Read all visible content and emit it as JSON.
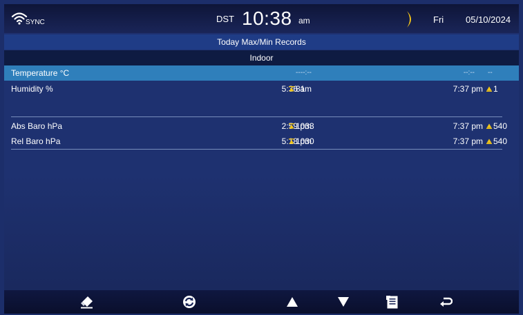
{
  "status": {
    "sync_label": "SYNC",
    "dst_label": "DST",
    "time": "10:38",
    "ampm": "am",
    "day": "Fri",
    "date": "05/10/2024"
  },
  "header": {
    "title": "Today Max/Min Records",
    "section": "Indoor"
  },
  "rows": [
    {
      "label": "Temperature °C",
      "max_time": "--:--",
      "max_value": "--",
      "min_time": "--:--",
      "min_value": "--",
      "selected": true
    },
    {
      "label": "Humidity %",
      "max_time": "5:36 am",
      "max_value": "81",
      "min_time": "7:37 pm",
      "min_value": "1"
    },
    {
      "label": "Abs Baro hPa",
      "max_time": "2:59 pm",
      "max_value": "1033",
      "min_time": "7:37 pm",
      "min_value": "540"
    },
    {
      "label": "Rel Baro hPa",
      "max_time": "5:18 pm",
      "max_value": "1030",
      "min_time": "7:37 pm",
      "min_value": "540"
    }
  ],
  "colors": {
    "background": "#1e3170",
    "selected_row": "#2f7fbb",
    "max_icon": "#f0c419",
    "min_icon": "#f0c419"
  },
  "toolbar": {
    "items": [
      "eraser-icon",
      "refresh-icon",
      "arrow-up-icon",
      "arrow-down-icon",
      "export-icon",
      "return-icon"
    ]
  }
}
